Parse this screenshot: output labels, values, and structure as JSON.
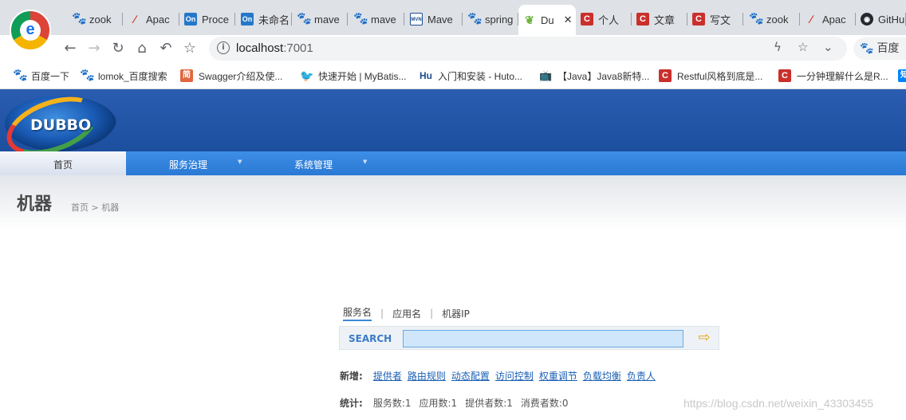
{
  "browser": {
    "tabs": [
      {
        "title": "zook",
        "icon": "baidu-paw-icon"
      },
      {
        "title": "Apac",
        "icon": "apache-feather-icon"
      },
      {
        "title": "Proce",
        "icon": "on-icon"
      },
      {
        "title": "未命名",
        "icon": "on-icon"
      },
      {
        "title": "mave",
        "icon": "baidu-paw-icon"
      },
      {
        "title": "mave",
        "icon": "baidu-paw-icon"
      },
      {
        "title": "Mave",
        "icon": "mvn-icon"
      },
      {
        "title": "spring",
        "icon": "baidu-paw-icon"
      },
      {
        "title": "Du",
        "icon": "spring-leaf-icon",
        "active": true
      },
      {
        "title": "个人",
        "icon": "csdn-icon"
      },
      {
        "title": "文章",
        "icon": "csdn-icon"
      },
      {
        "title": "写文",
        "icon": "csdn-icon"
      },
      {
        "title": "zook",
        "icon": "baidu-paw-icon"
      },
      {
        "title": "Apac",
        "icon": "apache-feather-icon"
      },
      {
        "title": "GitHu",
        "icon": "github-icon"
      }
    ],
    "url_host": "localhost",
    "url_port": ":7001",
    "search_engine": "百度",
    "bookmarks": [
      {
        "label": "百度一下",
        "icon": "baidu-paw-icon"
      },
      {
        "label": "lomok_百度搜索",
        "icon": "baidu-paw-icon"
      },
      {
        "label": "Swagger介绍及使...",
        "icon": "jian-icon"
      },
      {
        "label": "快速开始 | MyBatis...",
        "icon": "bird-icon"
      },
      {
        "label": "入门和安装 - Huto...",
        "icon": "hutool-icon"
      },
      {
        "label": "【Java】Java8新特...",
        "icon": "bilibili-icon"
      },
      {
        "label": "Restful风格到底是...",
        "icon": "csdn-icon"
      },
      {
        "label": "一分钟理解什么是R...",
        "icon": "csdn-icon"
      }
    ]
  },
  "app": {
    "logo_text": "DUBBO",
    "nav": [
      {
        "label": "首页",
        "active": true
      },
      {
        "label": "服务治理",
        "has_dropdown": true
      },
      {
        "label": "系统管理",
        "has_dropdown": true
      }
    ],
    "page_title": "机器",
    "breadcrumb": "首页 > 机器",
    "search": {
      "tabs": [
        "服务名",
        "应用名",
        "机器IP"
      ],
      "active_tab": "服务名",
      "label": "SEARCH",
      "value": ""
    },
    "add": {
      "label": "新增:",
      "links": [
        "提供者",
        "路由规则",
        "动态配置",
        "访问控制",
        "权重调节",
        "负载均衡",
        "负责人"
      ]
    },
    "stats": {
      "label": "统计:",
      "items": [
        "服务数:1",
        "应用数:1",
        "提供者数:1",
        "消费者数:0"
      ]
    },
    "watermark": "https://blog.csdn.net/weixin_43303455"
  }
}
